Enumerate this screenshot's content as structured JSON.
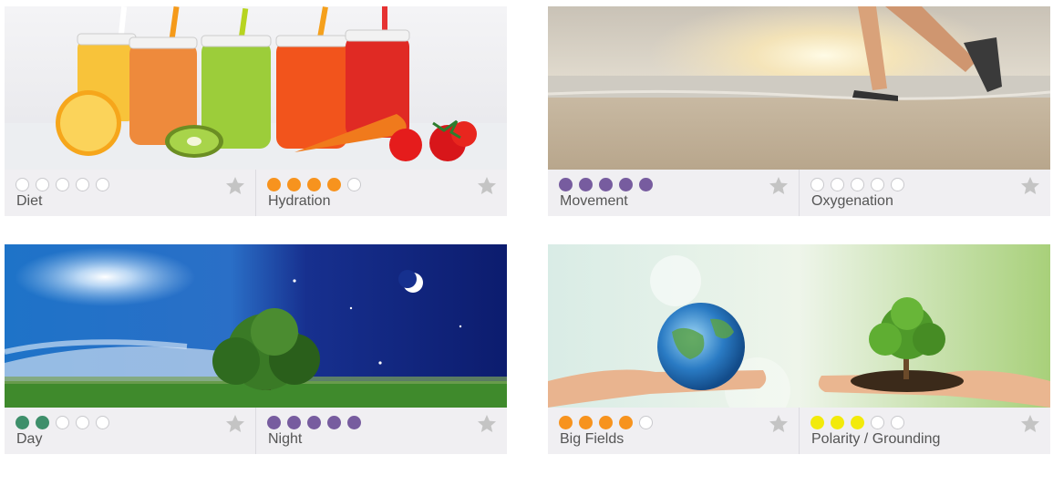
{
  "colors": {
    "purple": "#775c9f",
    "orange": "#f7931e",
    "green": "#3e8f6b",
    "yellow": "#f2ea0b",
    "empty": "#ffffff",
    "star": "#c4c4c4"
  },
  "cards": [
    {
      "image_icon": "juices-fruits-image",
      "items": [
        {
          "label": "Diet",
          "level": 0,
          "color": "#f7931e"
        },
        {
          "label": "Hydration",
          "level": 4,
          "color": "#f7931e"
        }
      ]
    },
    {
      "image_icon": "beach-runner-image",
      "items": [
        {
          "label": "Movement",
          "level": 5,
          "color": "#775c9f"
        },
        {
          "label": "Oxygenation",
          "level": 0,
          "color": "#775c9f"
        }
      ]
    },
    {
      "image_icon": "day-night-tree-image",
      "items": [
        {
          "label": "Day",
          "level": 2,
          "color": "#3e8f6b"
        },
        {
          "label": "Night",
          "level": 5,
          "color": "#775c9f"
        }
      ]
    },
    {
      "image_icon": "hands-earth-sapling-image",
      "items": [
        {
          "label": "Big Fields",
          "level": 4,
          "color": "#f7931e"
        },
        {
          "label": "Polarity / Grounding",
          "level": 3,
          "color": "#f2ea0b"
        }
      ]
    }
  ]
}
